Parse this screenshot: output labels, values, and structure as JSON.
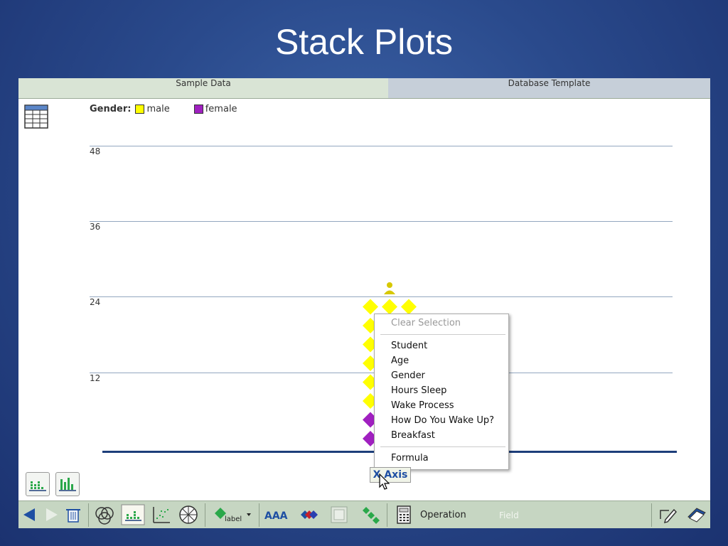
{
  "slide": {
    "title": "Stack Plots"
  },
  "tabs": [
    {
      "label": "Sample Data",
      "active": true
    },
    {
      "label": "Database Template",
      "active": false
    }
  ],
  "legend": {
    "attribute": "Gender:",
    "items": [
      {
        "label": "male",
        "color": "#ffff00"
      },
      {
        "label": "female",
        "color": "#a020c0"
      }
    ]
  },
  "chart_data": {
    "type": "scatter",
    "title": "",
    "ylabel": "",
    "y_ticks": [
      "48",
      "36",
      "24",
      "12"
    ],
    "ylim": [
      0,
      48
    ],
    "stack": [
      {
        "name": "male",
        "count": 18,
        "color": "#ffff00"
      },
      {
        "name": "female",
        "count": 6,
        "color": "#a020c0"
      }
    ],
    "columns": 3,
    "grid": true,
    "legend": "top-left"
  },
  "context_menu": {
    "header": "Clear Selection",
    "fields": [
      "Student",
      "Age",
      "Gender",
      "Hours Sleep",
      "Wake Process",
      "How Do You Wake Up?",
      "Breakfast"
    ],
    "footer": "Formula"
  },
  "axis_button": {
    "label": "X Axis"
  },
  "toolbar": {
    "operation_label": "Operation",
    "field_label": "Field",
    "label_button": "label",
    "font_button": "AAA"
  },
  "colors": {
    "male": "#ffff00",
    "female": "#a020c0",
    "axis": "#1d3e7a",
    "gridline": "#93a7c0",
    "toolbar": "#c6d6c2"
  }
}
